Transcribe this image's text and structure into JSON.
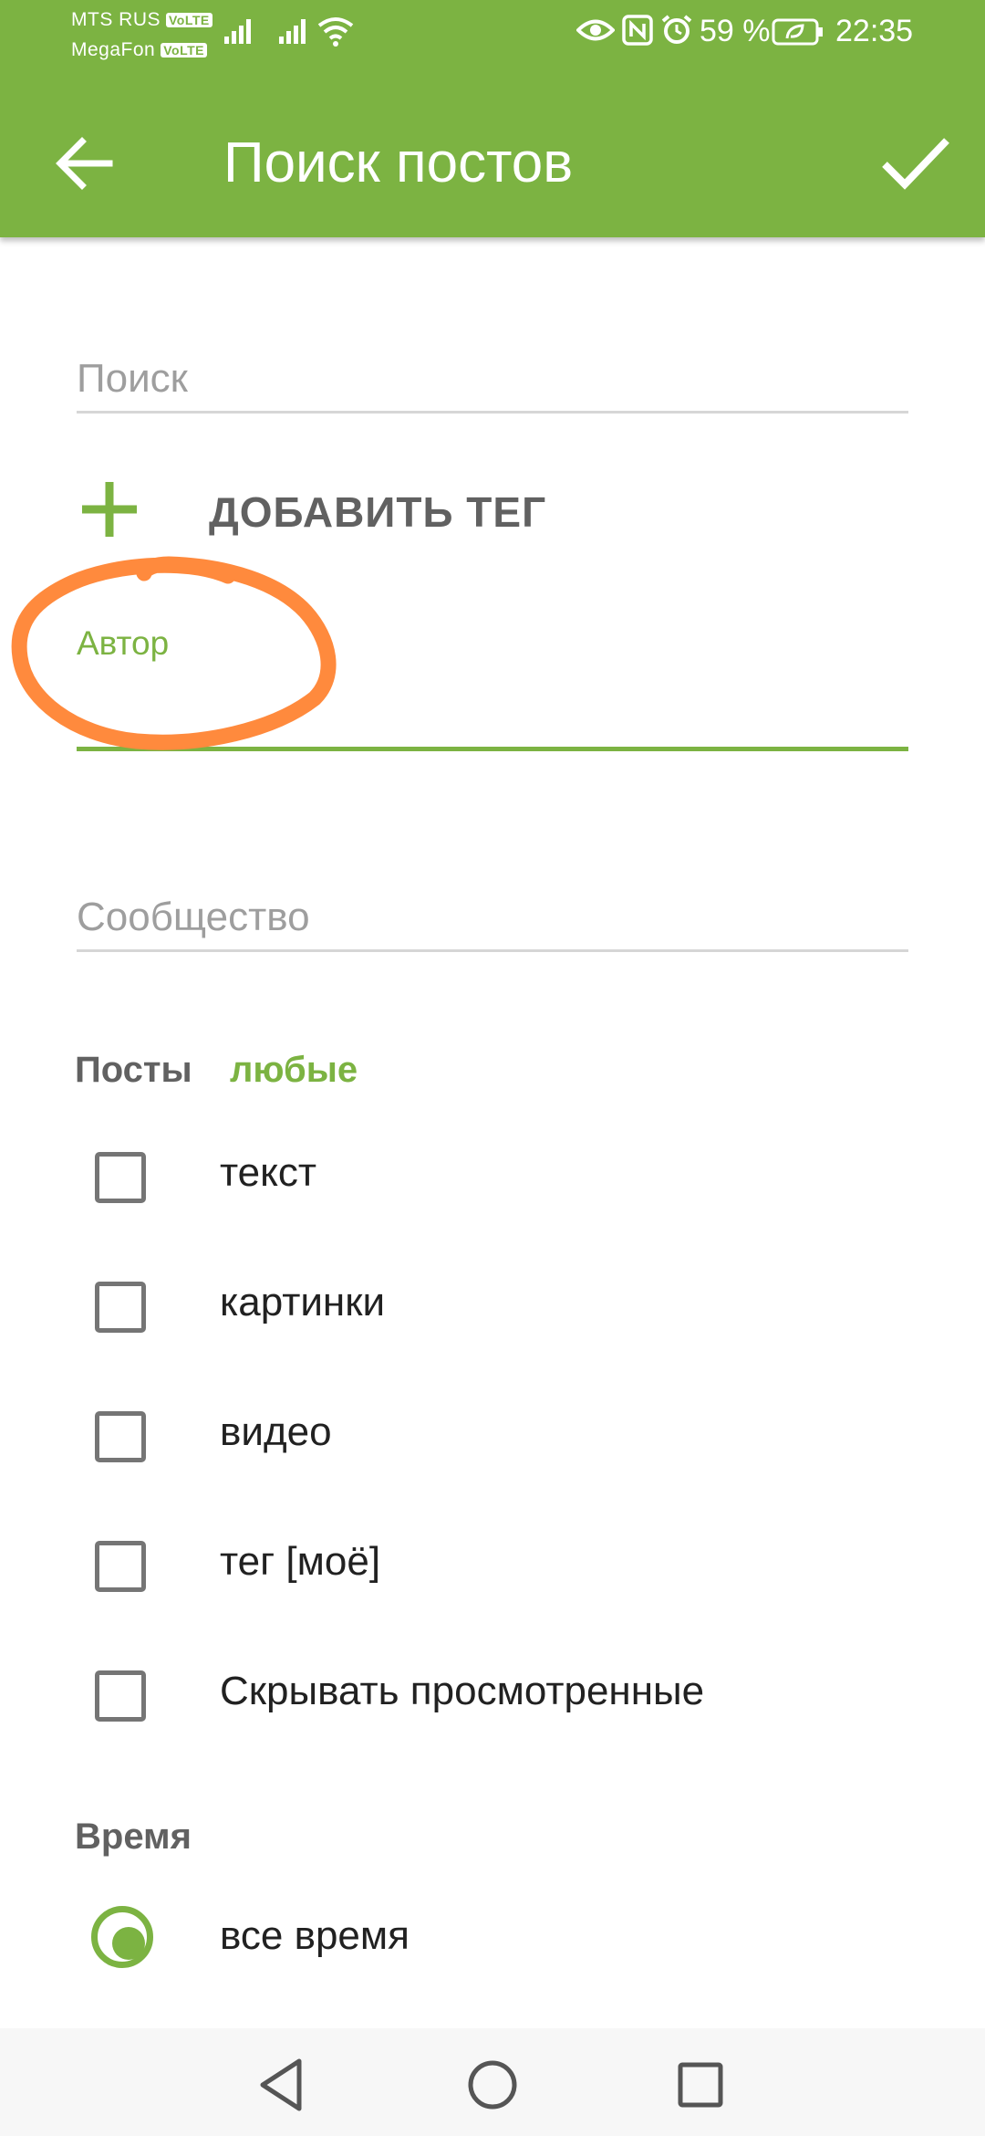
{
  "status_bar": {
    "carrier1": "MTS RUS",
    "carrier2": "MegaFon",
    "volte": "VoLTE",
    "battery": "59 %",
    "time": "22:35",
    "icons": [
      "signal-icon",
      "wifi-icon",
      "eye-icon",
      "nfc-icon",
      "alarm-icon",
      "battery-icon"
    ]
  },
  "app_bar": {
    "title": "Поиск постов",
    "back_icon": "arrow-left-icon",
    "confirm_icon": "check-icon"
  },
  "form": {
    "search_placeholder": "Поиск",
    "add_tag_label": "ДОБАВИТЬ ТЕГ",
    "author_label": "Автор",
    "author_value": "",
    "community_placeholder": "Сообщество"
  },
  "posts": {
    "title": "Посты",
    "filter_value": "любые",
    "options": [
      {
        "label": "текст",
        "checked": false
      },
      {
        "label": "картинки",
        "checked": false
      },
      {
        "label": "видео",
        "checked": false
      },
      {
        "label": "тег [моё]",
        "checked": false
      },
      {
        "label": "Скрывать просмотренные",
        "checked": false
      }
    ]
  },
  "time": {
    "title": "Время",
    "selected_option": "все время"
  },
  "nav_bar": {
    "icons": [
      "back-triangle-icon",
      "home-circle-icon",
      "recents-square-icon"
    ]
  },
  "colors": {
    "accent": "#7cb342",
    "annotation": "#ff8a3d"
  }
}
